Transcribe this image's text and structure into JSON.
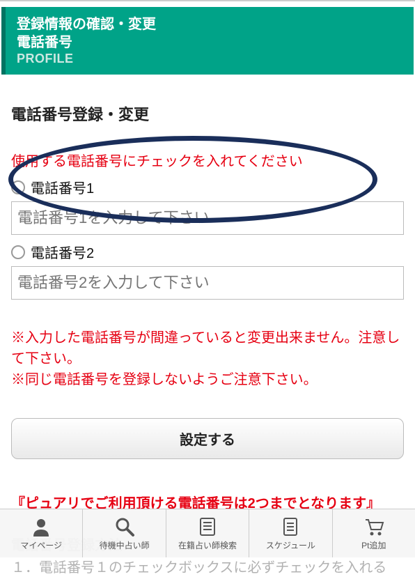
{
  "header": {
    "title1": "登録情報の確認・変更",
    "title2": "電話番号",
    "profile": "PROFILE"
  },
  "section": {
    "title": "電話番号登録・変更",
    "instruction": "使用する電話番号にチェックを入れてください"
  },
  "phone1": {
    "label": "電話番号1",
    "placeholder": "電話番号1を入力して下さい"
  },
  "phone2": {
    "label": "電話番号2",
    "placeholder": "電話番号2を入力して下さい"
  },
  "caution": {
    "line1": "※入力した電話番号が間違っていると変更出来ません。注意して下さい。",
    "line2": "※同じ電話番号を登録しないようご注意下さい。"
  },
  "submit": {
    "label": "設定する"
  },
  "notice": "『ピュアリでご利用頂ける電話番号は2つまでとなります』",
  "faded": {
    "title": "電話番号登録方法",
    "line": "１．電話番号１のチェックボックスに必ずチェックを入れる"
  },
  "nav": {
    "mypage": "マイページ",
    "waiting": "待機中占い師",
    "search": "在籍占い師検索",
    "schedule": "スケジュール",
    "pt": "Pt追加"
  }
}
